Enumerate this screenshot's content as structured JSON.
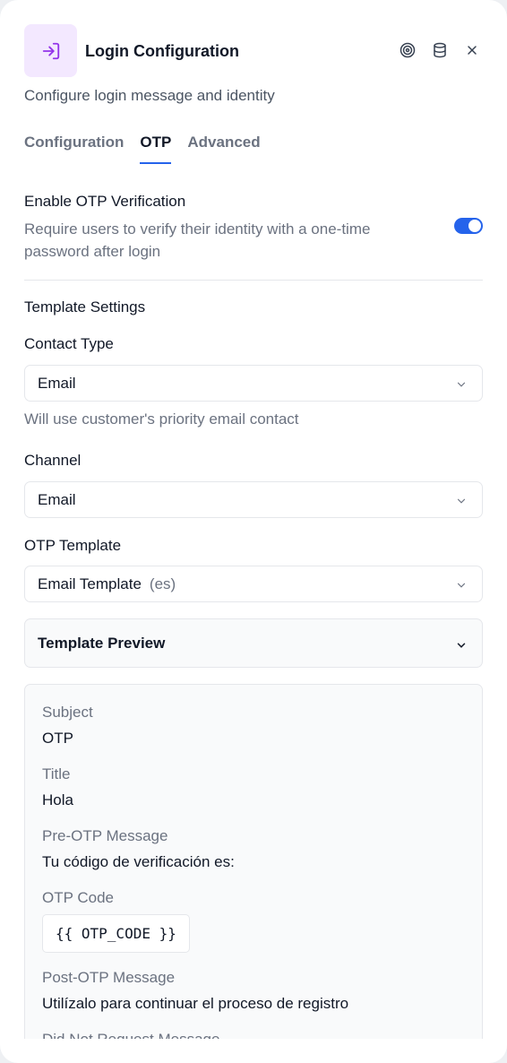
{
  "header": {
    "title": "Login Configuration",
    "subtitle": "Configure login message and identity",
    "icons": [
      "login-icon",
      "target-icon",
      "database-icon",
      "close-icon"
    ]
  },
  "tabs": [
    {
      "label": "Configuration",
      "active": false
    },
    {
      "label": "OTP",
      "active": true
    },
    {
      "label": "Advanced",
      "active": false
    }
  ],
  "otp": {
    "heading": "Enable OTP Verification",
    "description": "Require users to verify their identity with a one-time password after login",
    "enabled": true
  },
  "template_settings": {
    "heading": "Template Settings",
    "contact_type": {
      "label": "Contact Type",
      "value": "Email",
      "hint": "Will use customer's priority email contact"
    },
    "channel": {
      "label": "Channel",
      "value": "Email"
    },
    "otp_template": {
      "label": "OTP Template",
      "value": "Email Template",
      "lang": "(es)"
    }
  },
  "preview": {
    "toggle_label": "Template Preview",
    "subject_label": "Subject",
    "subject_value": "OTP",
    "title_label": "Title",
    "title_value": "Hola",
    "pre_label": "Pre-OTP Message",
    "pre_value": "Tu código de verificación es:",
    "code_label": "OTP Code",
    "code_value": "{{ OTP_CODE }}",
    "post_label": "Post-OTP Message",
    "post_value": "Utilízalo para continuar el proceso de registro",
    "not_requested_label": "Did Not Request Message"
  },
  "colors": {
    "accent": "#2563eb",
    "icon_bg": "#f3e8ff",
    "icon_fg": "#9333ea"
  }
}
